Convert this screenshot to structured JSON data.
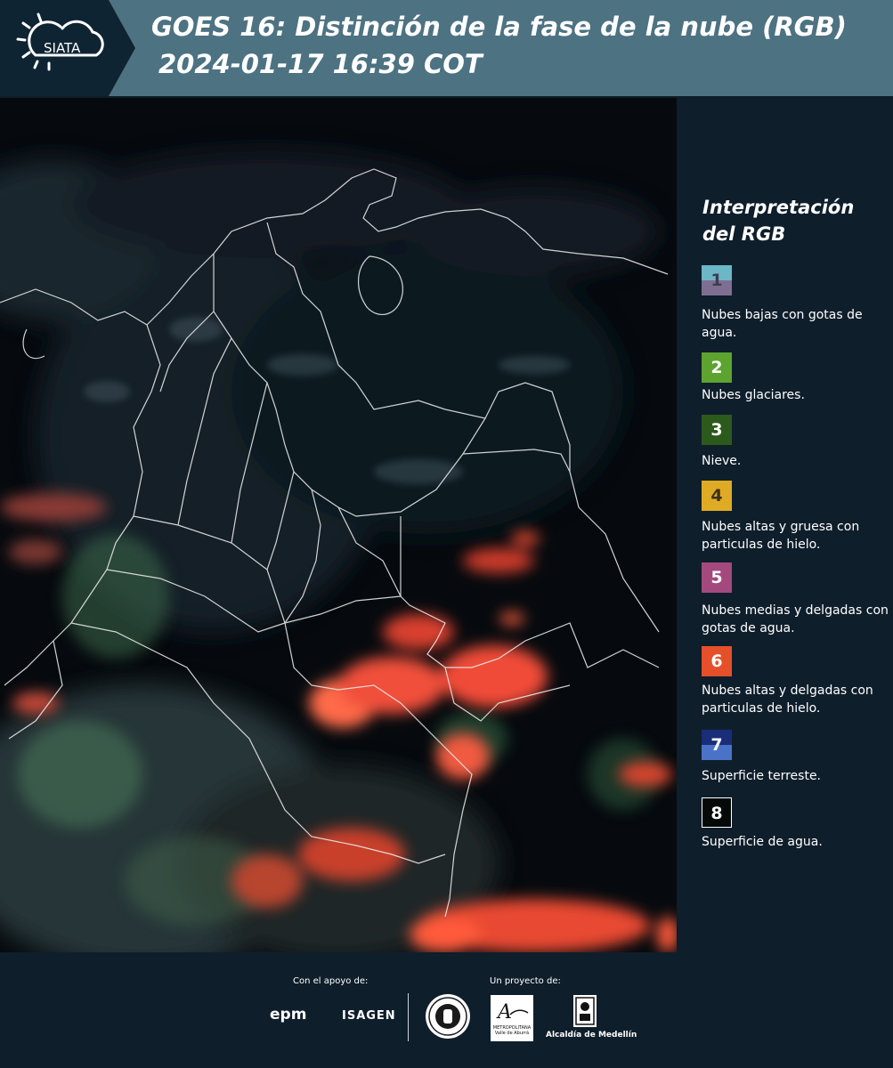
{
  "header": {
    "logo_text": "SIATA",
    "title_line1": "GOES 16: Distinción de la fase de la nube (RGB)",
    "title_line2": "2024-01-17 16:39 COT"
  },
  "legend": {
    "title": "Interpretación del RGB",
    "items": [
      {
        "number": "1",
        "label": "Nubes bajas con gotas de agua.",
        "colors": [
          "#6bb7c6",
          "#7e6f92"
        ],
        "text_color": "#3c3c54"
      },
      {
        "number": "2",
        "label": "Nubes glaciares.",
        "colors": [
          "#5da32f"
        ],
        "text_color": "#ffffff"
      },
      {
        "number": "3",
        "label": "Nieve.",
        "colors": [
          "#2c5a1c"
        ],
        "text_color": "#ffffff"
      },
      {
        "number": "4",
        "label": "Nubes altas y gruesa con particulas de hielo.",
        "colors": [
          "#e0ab24"
        ],
        "text_color": "#3a3018"
      },
      {
        "number": "5",
        "label": "Nubes medias y delgadas con gotas de agua.",
        "colors": [
          "#a3497e"
        ],
        "text_color": "#ffffff"
      },
      {
        "number": "6",
        "label": "Nubes altas y delgadas con particulas de hielo.",
        "colors": [
          "#e5502a"
        ],
        "text_color": "#ffffff"
      },
      {
        "number": "7",
        "label": "Superficie terreste.",
        "colors": [
          "#1a2d78",
          "#4a73c8"
        ],
        "text_color": "#ffffff"
      },
      {
        "number": "8",
        "label": "Superficie de agua.",
        "colors": [
          "#050a08"
        ],
        "text_color": "#ffffff"
      }
    ]
  },
  "footer": {
    "support_label": "Con el apoyo de:",
    "project_label": "Un proyecto de:",
    "epm": "epm",
    "isagen": "ISAGEN",
    "area_text": "METROPOLITANA Valle de Aburrá",
    "medellin": "Alcaldía de Medellín"
  }
}
